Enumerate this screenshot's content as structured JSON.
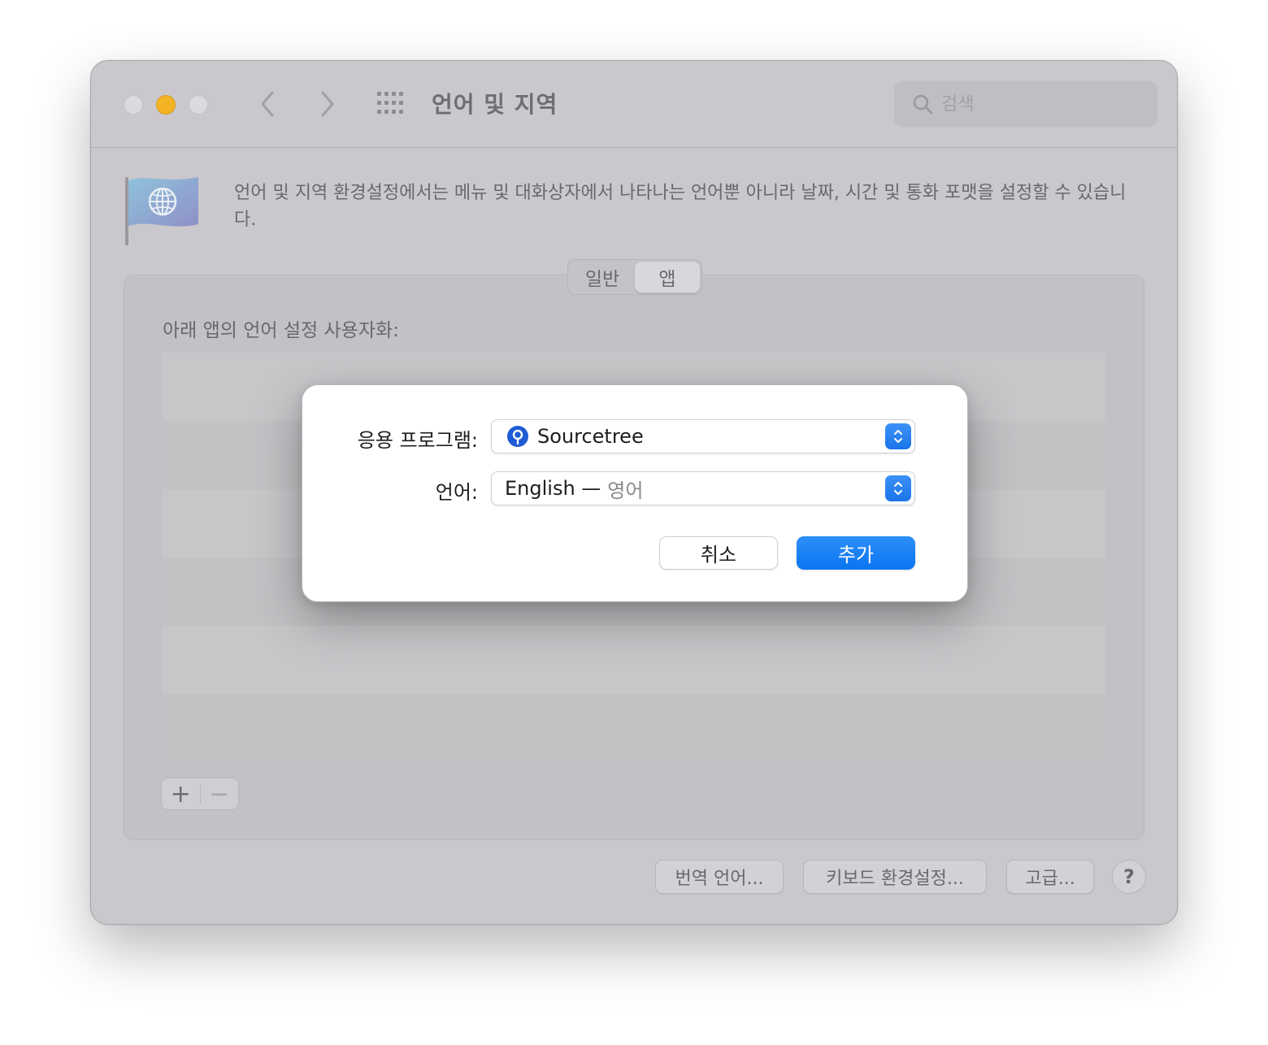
{
  "window": {
    "title": "언어 및 지역",
    "search_placeholder": "검색"
  },
  "intro": {
    "text": "언어 및 지역 환경설정에서는 메뉴 및 대화상자에서 나타나는 언어뿐 아니라 날짜, 시간 및 통화 포맷을 설정할 수 있습니다."
  },
  "tabs": [
    {
      "label": "일반",
      "selected": false
    },
    {
      "label": "앱",
      "selected": true
    }
  ],
  "apps_panel": {
    "customize_label": "아래 앱의 언어 설정 사용자화:",
    "add_label": "+",
    "remove_label": "−"
  },
  "bottom_buttons": {
    "translation": "번역 언어...",
    "keyboard": "키보드 환경설정...",
    "advanced": "고급...",
    "help": "?"
  },
  "dialog": {
    "app_label": "응용 프로그램:",
    "app_value": "Sourcetree",
    "app_icon": "sourcetree-icon",
    "language_label": "언어:",
    "language_value": "English —",
    "language_native": "영어",
    "cancel": "취소",
    "add": "추가"
  },
  "colors": {
    "accent": "#0a75f0",
    "minimize": "#f5b425",
    "window_bg": "#cac8cc"
  }
}
